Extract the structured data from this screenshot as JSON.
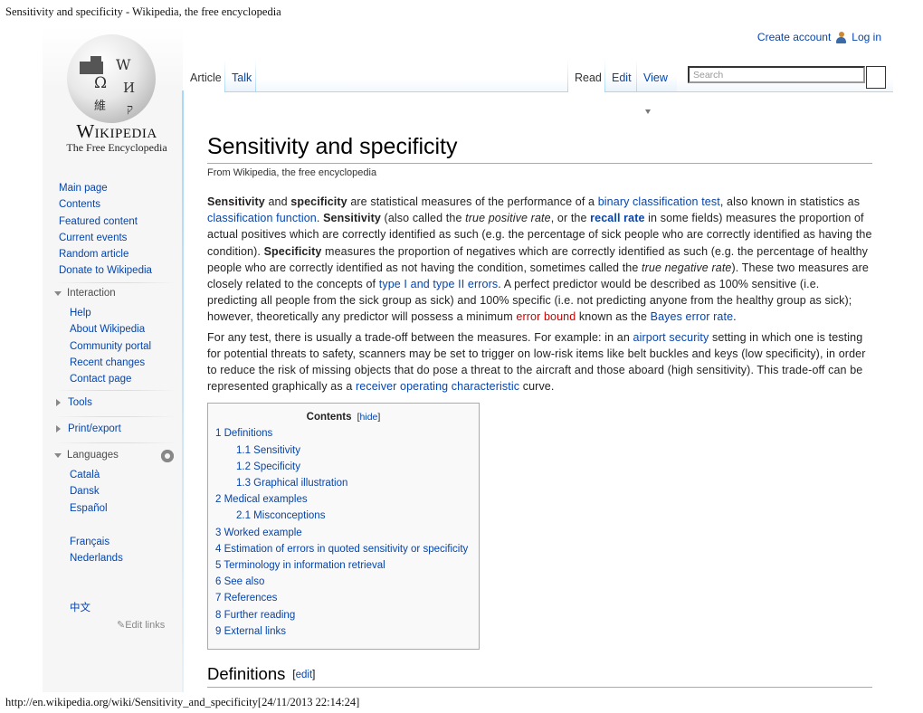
{
  "print_header": {
    "title": "Sensitivity and specificity - Wikipedia, the free encyclopedia"
  },
  "print_footer": {
    "url": "http://en.wikipedia.org/wiki/Sensitivity_and_specificity[24/11/2013 22:14:24]"
  },
  "personal": {
    "create_account": "Create account",
    "log_in": "Log in"
  },
  "logo": {
    "wordmark": "Wikipedia",
    "tagline": "The Free Encyclopedia",
    "glyphs": [
      "Ω",
      "W",
      "И",
      "維",
      "ק"
    ]
  },
  "sidebar": {
    "navigation": [
      {
        "label": "Main page"
      },
      {
        "label": "Contents"
      },
      {
        "label": "Featured content"
      },
      {
        "label": "Current events"
      },
      {
        "label": "Random article"
      },
      {
        "label": "Donate to Wikipedia"
      }
    ],
    "interaction": {
      "heading": "Interaction",
      "items": [
        {
          "label": "Help"
        },
        {
          "label": "About Wikipedia"
        },
        {
          "label": "Community portal"
        },
        {
          "label": "Recent changes"
        },
        {
          "label": "Contact page"
        }
      ]
    },
    "tools": {
      "heading": "Tools"
    },
    "print_export": {
      "heading": "Print/export"
    },
    "languages": {
      "heading": "Languages",
      "items": [
        {
          "label": "Català"
        },
        {
          "label": "Dansk"
        },
        {
          "label": "Español"
        },
        {
          "label": "Français"
        },
        {
          "label": "Nederlands"
        },
        {
          "label": "中文"
        }
      ],
      "edit_links": "Edit links"
    }
  },
  "tabs": {
    "left": [
      {
        "label": "Article",
        "selected": true
      },
      {
        "label": "Talk",
        "selected": false
      }
    ],
    "right": [
      {
        "label": "Read",
        "selected": true
      },
      {
        "label": "Edit",
        "selected": false
      },
      {
        "label": "View",
        "selected": false
      }
    ]
  },
  "search": {
    "placeholder": "Search",
    "value": ""
  },
  "article": {
    "title": "Sensitivity and specificity",
    "site_sub": "From Wikipedia, the free encyclopedia",
    "p1": {
      "b1": "Sensitivity",
      "t1": " and ",
      "b2": "specificity",
      "t2": " are statistical measures of the performance of a ",
      "l1": "binary classification test",
      "t3": ", also known in statistics as ",
      "l2": "classification function",
      "t4": ". ",
      "b3": "Sensitivity",
      "t5": " (also called the ",
      "i1": "true positive rate",
      "t6": ", or the ",
      "l3": "recall rate",
      "t7": " in some fields) measures the proportion of actual positives which are correctly identified as such (e.g. the percentage of sick people who are correctly identified as having the condition). ",
      "b4": "Specificity",
      "t8": " measures the proportion of negatives which are correctly identified as such (e.g. the percentage of healthy people who are correctly identified as not having the condition, sometimes called the ",
      "i2": "true negative rate",
      "t9": "). These two measures are closely related to the concepts of ",
      "l4": "type I and type II errors",
      "t10": ". A perfect predictor would be described as 100% sensitive (i.e. predicting all people from the sick group as sick) and 100% specific (i.e. not predicting anyone from the healthy group as sick); however, theoretically any predictor will possess a minimum ",
      "l5": "error bound",
      "t11": " known as the ",
      "l6": "Bayes error rate",
      "t12": "."
    },
    "p2": {
      "t1": "For any test, there is usually a trade-off between the measures. For example: in an ",
      "l1": "airport security",
      "t2": " setting in which one is testing for potential threats to safety, scanners may be set to trigger on low-risk items like belt buckles and keys (low specificity), in order to reduce the risk of missing objects that do pose a threat to the aircraft and those aboard (high sensitivity). This trade-off can be represented graphically as a ",
      "l2": "receiver operating characteristic",
      "t3": " curve."
    },
    "toc": {
      "title": "Contents",
      "hide": "hide",
      "items": [
        {
          "label": "1 Definitions",
          "level": 1
        },
        {
          "label": "1.1 Sensitivity",
          "level": 2
        },
        {
          "label": "1.2 Specificity",
          "level": 2
        },
        {
          "label": "1.3 Graphical illustration",
          "level": 2
        },
        {
          "label": "2 Medical examples",
          "level": 1
        },
        {
          "label": "2.1 Misconceptions",
          "level": 2
        },
        {
          "label": "3 Worked example",
          "level": 1
        },
        {
          "label": "4 Estimation of errors in quoted sensitivity or specificity",
          "level": 1
        },
        {
          "label": "5 Terminology in information retrieval",
          "level": 1
        },
        {
          "label": "6 See also",
          "level": 1
        },
        {
          "label": "7 References",
          "level": 1
        },
        {
          "label": "8 Further reading",
          "level": 1
        },
        {
          "label": "9 External links",
          "level": 1
        }
      ]
    },
    "section1": {
      "heading": "Definitions",
      "edit": "edit"
    }
  },
  "colors": {
    "link": "#0645ad",
    "redlink": "#cc0000",
    "sidebar_bg": "#f6f6f6",
    "tab_border": "#a7d7f9"
  }
}
